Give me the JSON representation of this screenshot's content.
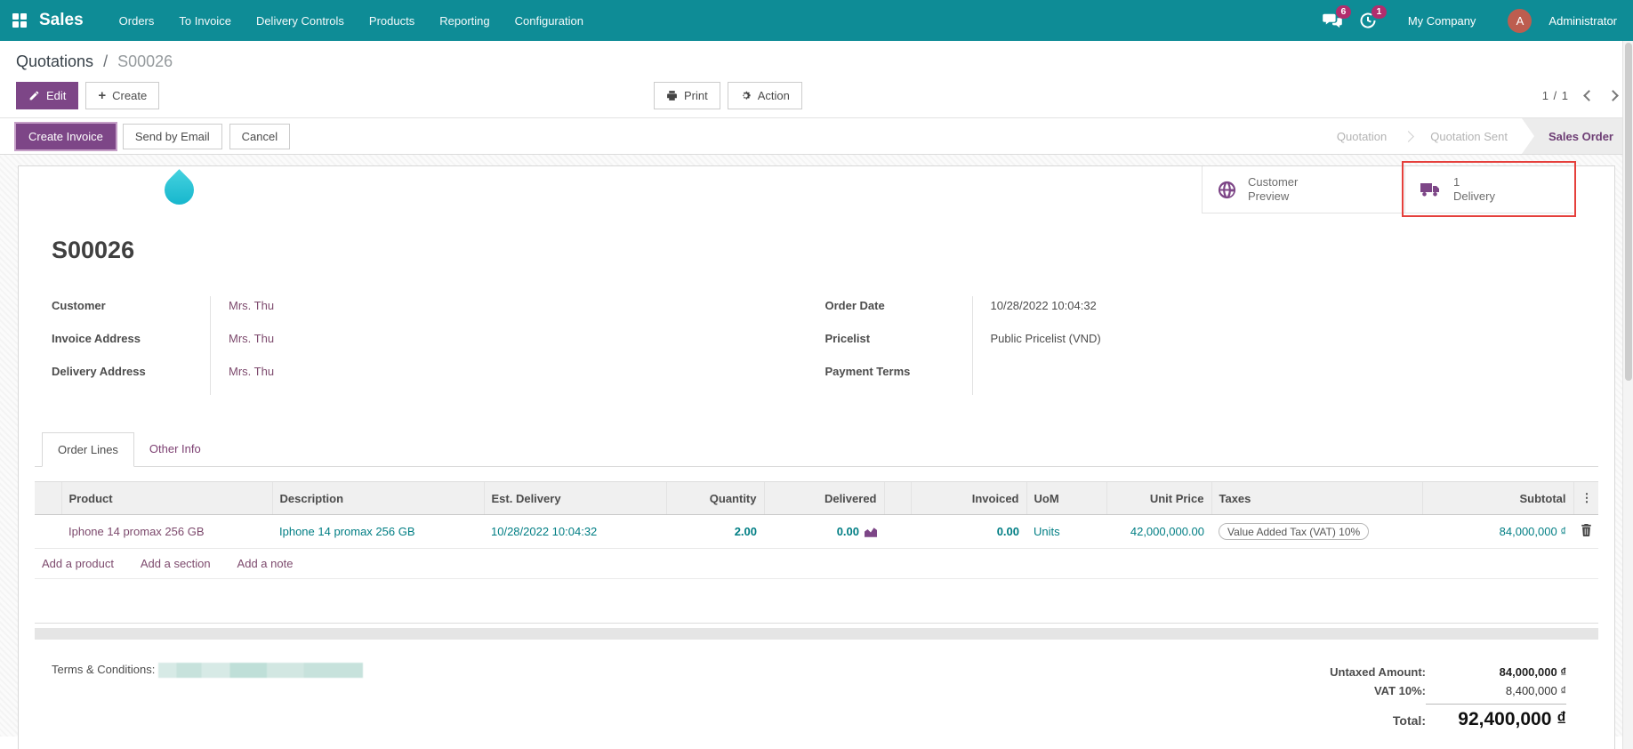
{
  "navbar": {
    "app": "Sales",
    "menus": [
      "Orders",
      "To Invoice",
      "Delivery Controls",
      "Products",
      "Reporting",
      "Configuration"
    ],
    "messages_badge": "6",
    "activities_badge": "1",
    "company": "My Company",
    "avatar_letter": "A",
    "user": "Administrator"
  },
  "breadcrumb": {
    "parent": "Quotations",
    "separator": "/",
    "current": "S00026"
  },
  "actions": {
    "edit": "Edit",
    "create": "Create",
    "print": "Print",
    "action": "Action",
    "pager": "1 / 1"
  },
  "statusbar": {
    "buttons": [
      "Create Invoice",
      "Send by Email",
      "Cancel"
    ],
    "steps": [
      "Quotation",
      "Quotation Sent",
      "Sales Order"
    ],
    "active_step": "Sales Order"
  },
  "stat_buttons": {
    "preview_label": "Customer Preview",
    "delivery_count": "1",
    "delivery_label": "Delivery"
  },
  "form": {
    "title": "S00026",
    "left_fields": [
      {
        "label": "Customer",
        "value": "Mrs. Thu"
      },
      {
        "label": "Invoice Address",
        "value": "Mrs. Thu"
      },
      {
        "label": "Delivery Address",
        "value": "Mrs. Thu"
      }
    ],
    "right_fields": [
      {
        "label": "Order Date",
        "value": "10/28/2022 10:04:32"
      },
      {
        "label": "Pricelist",
        "value": "Public Pricelist (VND)"
      },
      {
        "label": "Payment Terms",
        "value": ""
      }
    ]
  },
  "tabs": {
    "order_lines": "Order Lines",
    "other_info": "Other Info"
  },
  "table": {
    "columns": [
      "Product",
      "Description",
      "Est. Delivery",
      "Quantity",
      "Delivered",
      "Invoiced",
      "UoM",
      "Unit Price",
      "Taxes",
      "Subtotal"
    ],
    "row": {
      "product": "Iphone 14 promax 256 GB",
      "description": "Iphone 14 promax 256 GB",
      "est_delivery": "10/28/2022 10:04:32",
      "quantity": "2.00",
      "delivered": "0.00",
      "invoiced": "0.00",
      "uom": "Units",
      "unit_price": "42,000,000.00",
      "taxes": "Value Added Tax (VAT) 10%",
      "subtotal": "84,000,000 ₫"
    },
    "footer_links": [
      "Add a product",
      "Add a section",
      "Add a note"
    ]
  },
  "terms": {
    "label": "Terms & Conditions:"
  },
  "totals": {
    "untaxed_label": "Untaxed Amount:",
    "untaxed_value": "84,000,000 ₫",
    "vat_label": "VAT 10%:",
    "vat_value": "8,400,000 ₫",
    "total_label": "Total:",
    "total_value": "92,400,000 ₫"
  },
  "icons": {
    "dots_glyph": "⋮",
    "plus_glyph": "+"
  },
  "colors": {
    "navbar": "#0e8c96",
    "primary": "#7d4687",
    "link": "#017e84",
    "mauve": "#7d4a6d",
    "badge": "#b12d6d",
    "avatar": "#bd5d4f",
    "highlight": "#e5403c",
    "drop": "#1fc0d4"
  }
}
